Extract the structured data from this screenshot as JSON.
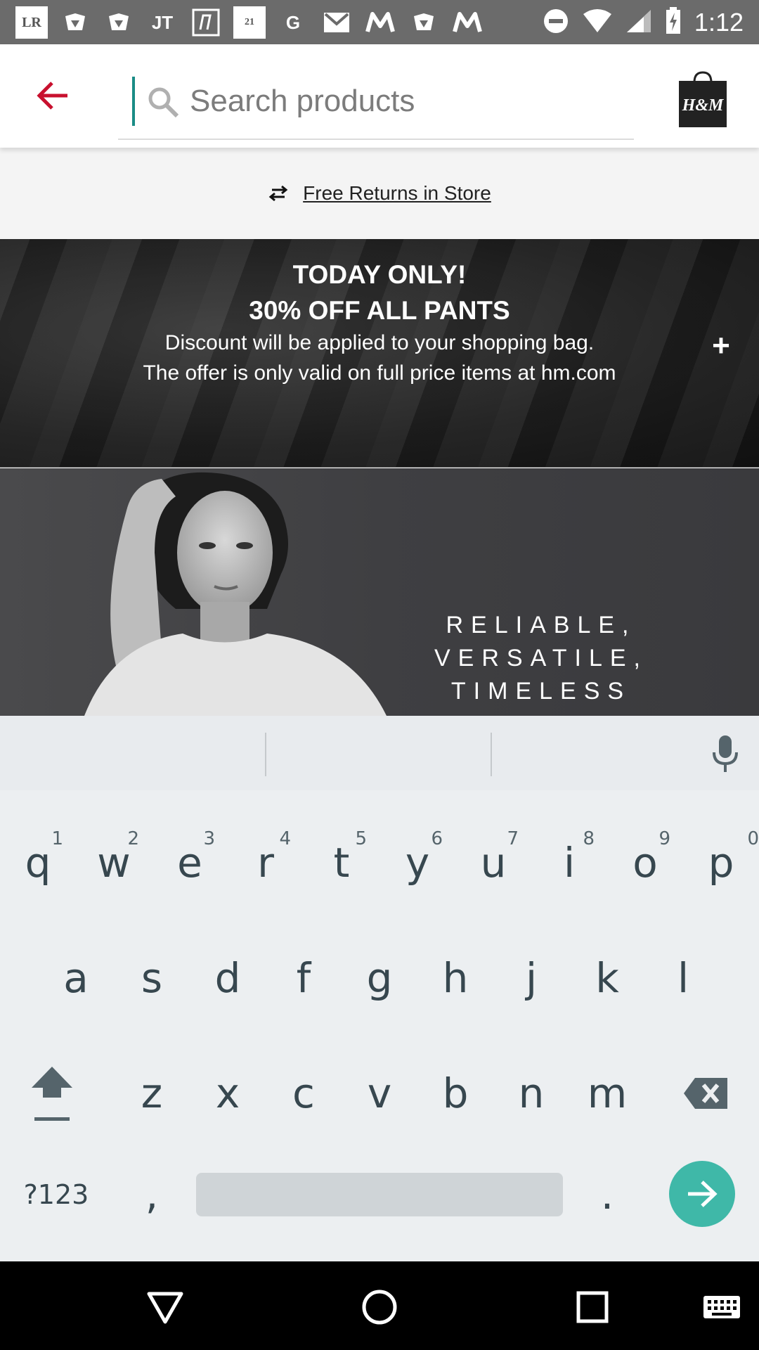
{
  "status_bar": {
    "time": "1:12",
    "notification_icons": [
      "LR",
      "google-photos-icon",
      "google-photos-icon",
      "JT",
      "jobs-icon",
      "21",
      "G",
      "gmail-icon",
      "myntra-icon",
      "google-photos-icon",
      "myntra-icon"
    ]
  },
  "app_bar": {
    "search_placeholder": "Search products",
    "bag_logo": "H&M"
  },
  "returns_banner": {
    "label": "Free Returns in Store"
  },
  "promo": {
    "title_line1": "TODAY ONLY!",
    "title_line2": "30% OFF ALL PANTS",
    "text_line1": "Discount will be applied to your shopping bag.",
    "text_line2": "The offer is only valid on full price items at hm.com",
    "expand_label": "+"
  },
  "hero": {
    "line1": "RELIABLE,",
    "line2": "VERSATILE,",
    "line3": "TIMELESS"
  },
  "keyboard": {
    "row1": [
      {
        "key": "q",
        "hint": "1"
      },
      {
        "key": "w",
        "hint": "2"
      },
      {
        "key": "e",
        "hint": "3"
      },
      {
        "key": "r",
        "hint": "4"
      },
      {
        "key": "t",
        "hint": "5"
      },
      {
        "key": "y",
        "hint": "6"
      },
      {
        "key": "u",
        "hint": "7"
      },
      {
        "key": "i",
        "hint": "8"
      },
      {
        "key": "o",
        "hint": "9"
      },
      {
        "key": "p",
        "hint": "0"
      }
    ],
    "row2": [
      "a",
      "s",
      "d",
      "f",
      "g",
      "h",
      "j",
      "k",
      "l"
    ],
    "row3": [
      "z",
      "x",
      "c",
      "v",
      "b",
      "n",
      "m"
    ],
    "symbols_label": "?123",
    "comma_label": ",",
    "period_label": "."
  },
  "colors": {
    "accent_red": "#c8102e",
    "caret_teal": "#1a8c86",
    "enter_teal": "#3fb8a8",
    "keyboard_bg": "#eceff1",
    "key_text": "#37474f"
  }
}
